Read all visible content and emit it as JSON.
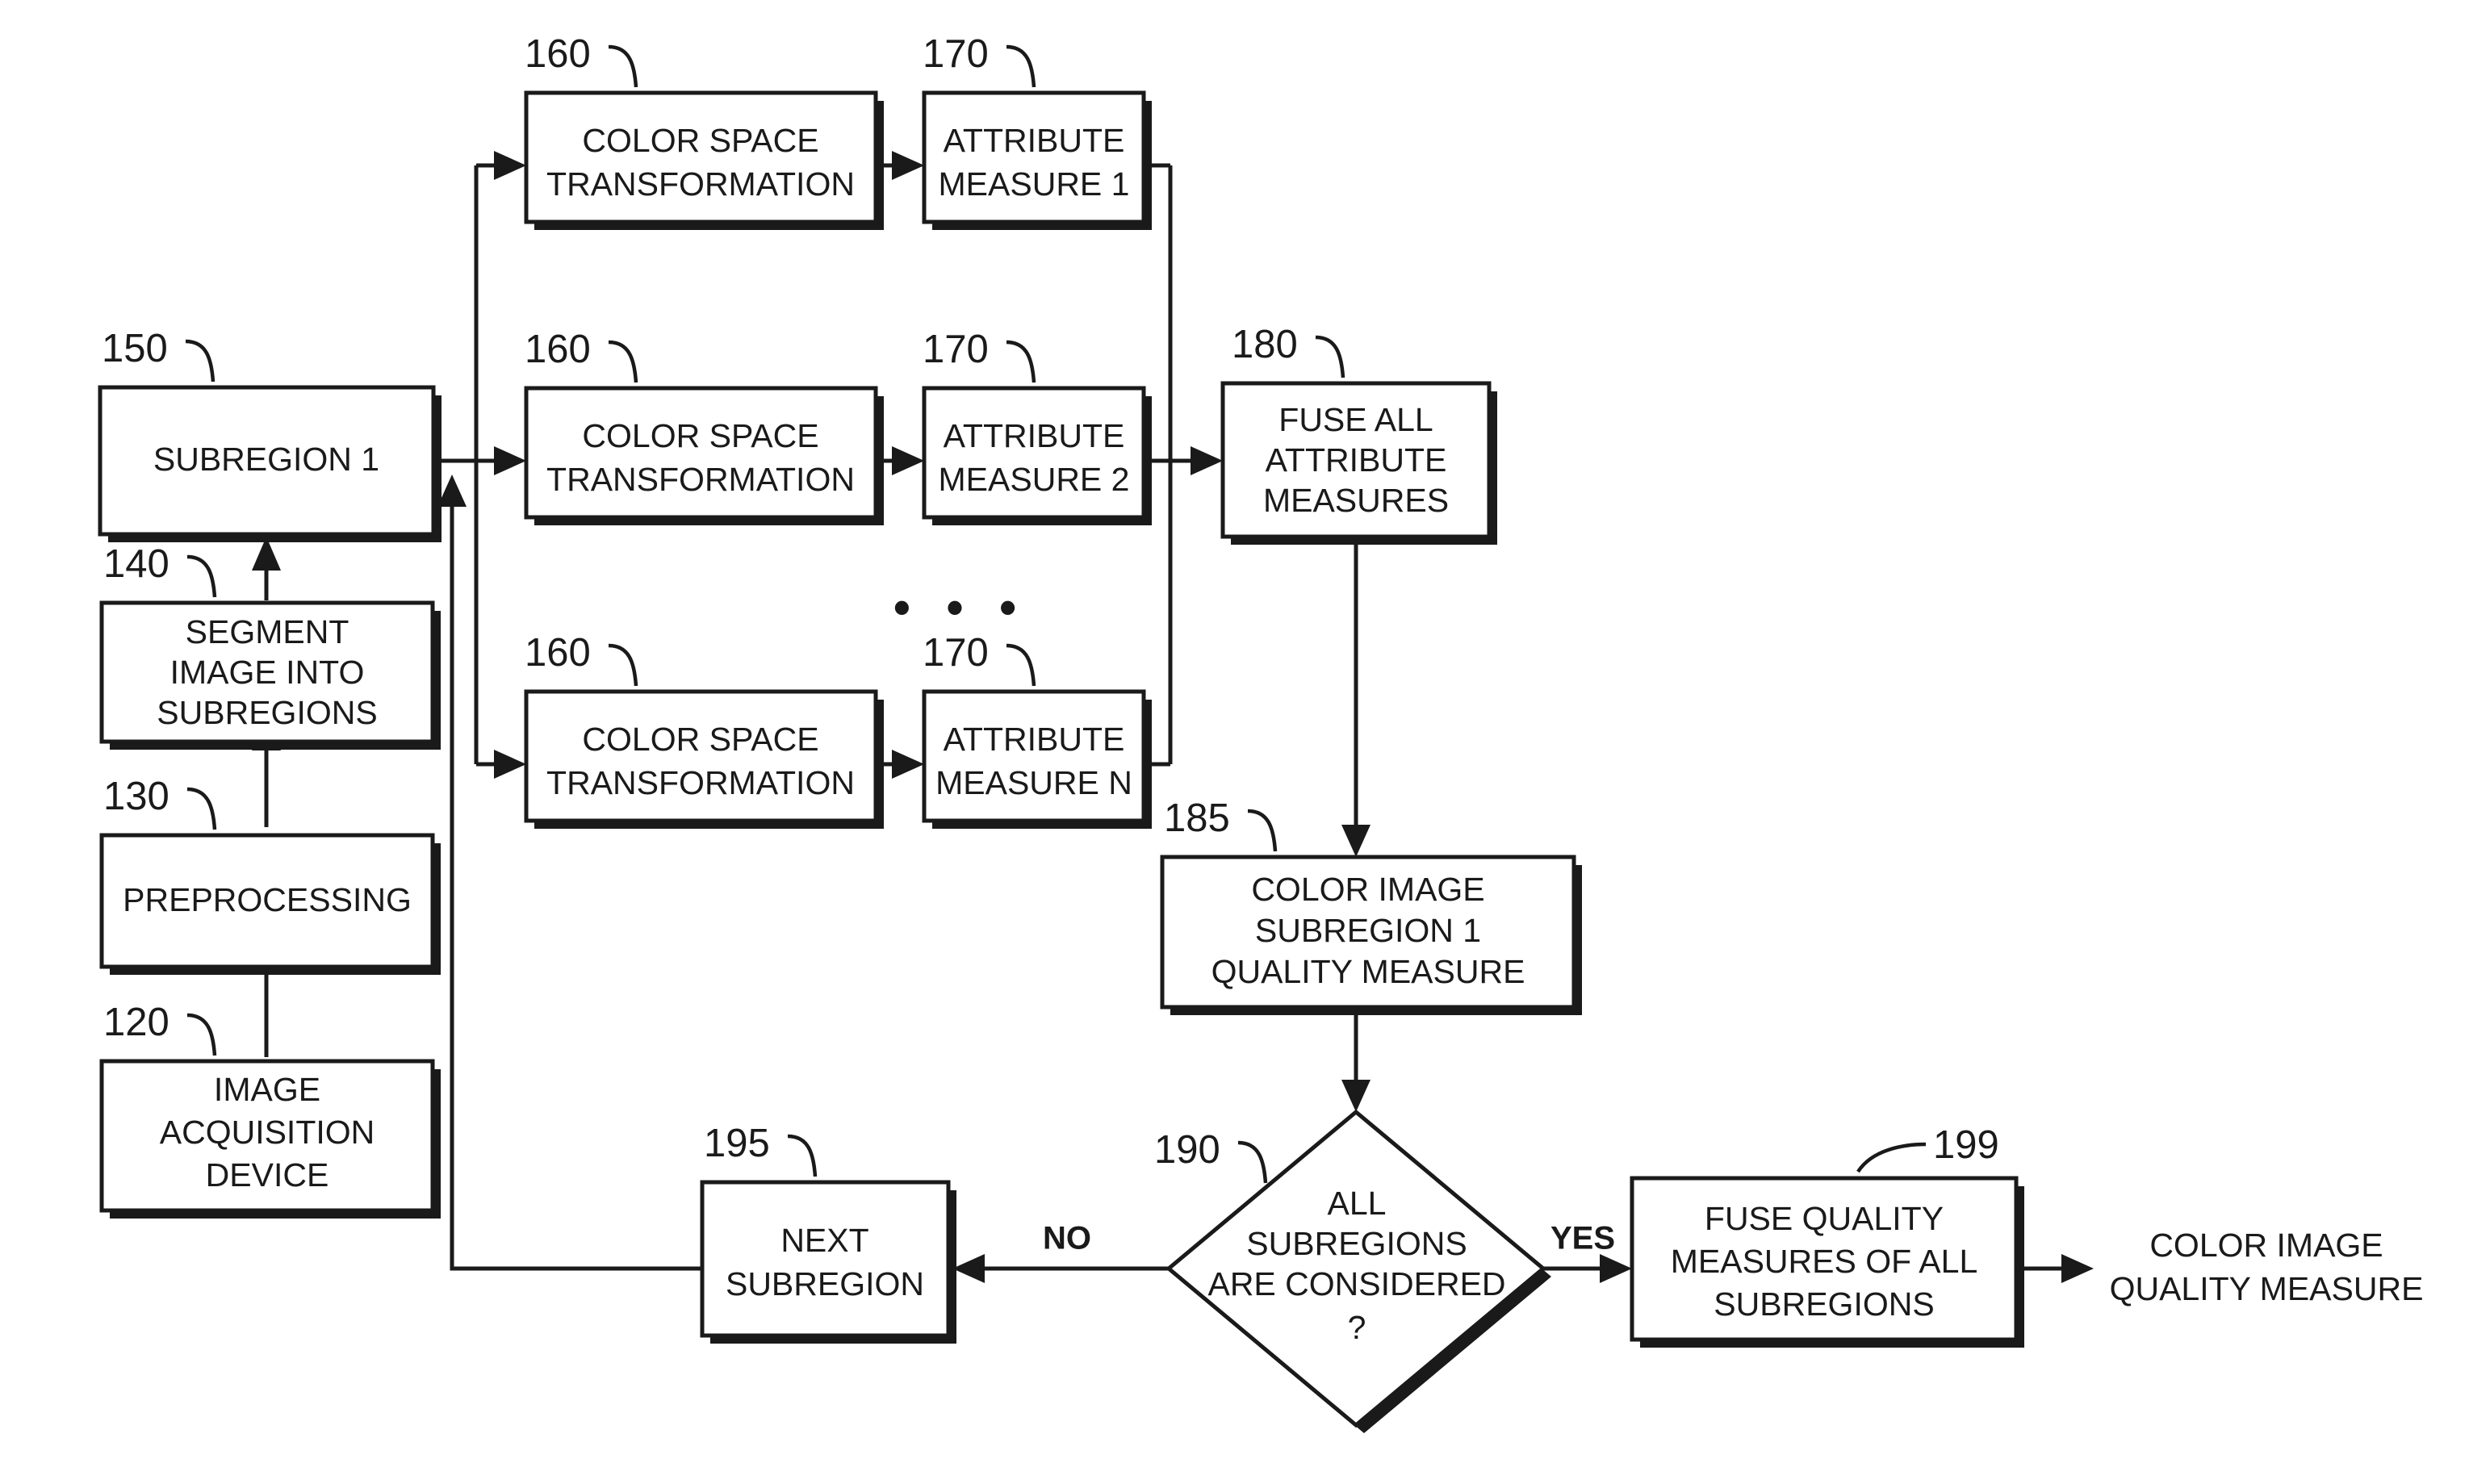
{
  "diagram": {
    "type": "patent-flowchart",
    "background_color": "#ffffff",
    "line_color": "#1a1a1a",
    "nodes": {
      "image_acquisition": {
        "ref": "120",
        "label_line1": "IMAGE",
        "label_line2": "ACQUISITION",
        "label_line3": "DEVICE"
      },
      "preprocessing": {
        "ref": "130",
        "label_line1": "PREPROCESSING"
      },
      "segment": {
        "ref": "140",
        "label_line1": "SEGMENT",
        "label_line2": "IMAGE INTO",
        "label_line3": "SUBREGIONS"
      },
      "subregion1": {
        "ref": "150",
        "label_line1": "SUBREGION 1"
      },
      "cst1": {
        "ref": "160",
        "label_line1": "COLOR SPACE",
        "label_line2": "TRANSFORMATION"
      },
      "cst2": {
        "ref": "160",
        "label_line1": "COLOR SPACE",
        "label_line2": "TRANSFORMATION"
      },
      "cstN": {
        "ref": "160",
        "label_line1": "COLOR SPACE",
        "label_line2": "TRANSFORMATION"
      },
      "attr1": {
        "ref": "170",
        "label_line1": "ATTRIBUTE",
        "label_line2": "MEASURE 1"
      },
      "attr2": {
        "ref": "170",
        "label_line1": "ATTRIBUTE",
        "label_line2": "MEASURE 2"
      },
      "attrN": {
        "ref": "170",
        "label_line1": "ATTRIBUTE",
        "label_line2": "MEASURE N"
      },
      "fuse_attr": {
        "ref": "180",
        "label_line1": "FUSE ALL",
        "label_line2": "ATTRIBUTE",
        "label_line3": "MEASURES"
      },
      "subregion_quality": {
        "ref": "185",
        "label_line1": "COLOR IMAGE",
        "label_line2": "SUBREGION 1",
        "label_line3": "QUALITY MEASURE"
      },
      "decision": {
        "ref": "190",
        "label_line1": "ALL",
        "label_line2": "SUBREGIONS",
        "label_line3": "ARE CONSIDERED",
        "label_line4": "?"
      },
      "next_subregion": {
        "ref": "195",
        "label_line1": "NEXT",
        "label_line2": "SUBREGION"
      },
      "fuse_quality": {
        "ref": "199",
        "label_line1": "FUSE QUALITY",
        "label_line2": "MEASURES OF ALL",
        "label_line3": "SUBREGIONS"
      },
      "final_output": {
        "label_line1": "COLOR IMAGE",
        "label_line2": "QUALITY MEASURE"
      }
    },
    "edge_labels": {
      "no_branch": "NO",
      "yes_branch": "YES"
    },
    "ellipsis": "• • •"
  }
}
